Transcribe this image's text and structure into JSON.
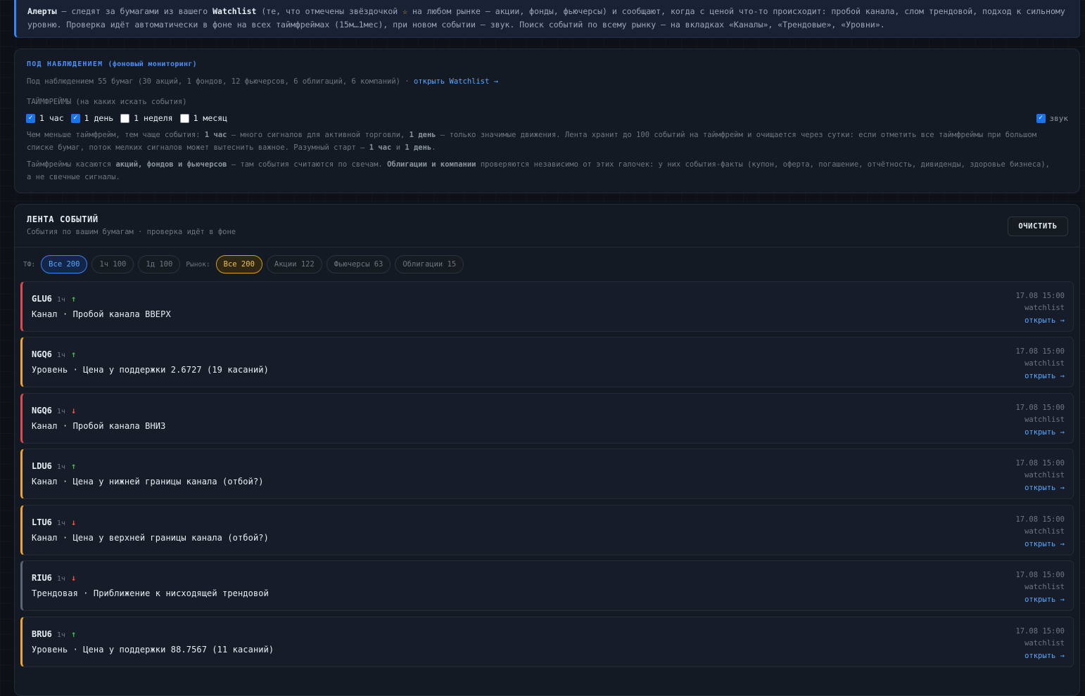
{
  "info_banner": {
    "b1": "Алерты",
    "t1": " — следят за бумагами из вашего ",
    "b2": "Watchlist",
    "t2": " (те, что отмечены звёздочкой ",
    "star": "☆",
    "t3": " на любом рынке — акции, фонды, фьючерсы) и сообщают, когда с ценой что-то происходит: пробой канала, слом трендовой, подход к сильному уровню. Проверка идёт автоматически в фоне на всех таймфреймах (15м…1мес), при новом событии — звук. Поиск событий по всему рынку — на вкладках «Каналы», «Трендовые», «Уровни»."
  },
  "monitoring": {
    "title": "ПОД НАБЛЮДЕНИЕМ",
    "title_sub": "(фоновый мониторинг)",
    "count_text": "Под наблюдением 55 бумаг (30 акций, 1 фондов, 12 фьючерсов, 6 облигаций, 6 компаний) · ",
    "watchlist_link": "открыть Watchlist →",
    "timeframes_title": "ТАЙМФРЕЙМЫ (на каких искать события)",
    "timeframes": [
      {
        "label": "1 час",
        "checked": true
      },
      {
        "label": "1 день",
        "checked": true
      },
      {
        "label": "1 неделя",
        "checked": false
      },
      {
        "label": "1 месяц",
        "checked": false
      }
    ],
    "sound": {
      "label": "звук",
      "checked": true
    },
    "note1": {
      "a": "Чем меньше таймфрейм, тем чаще события: ",
      "b": "1 час",
      "c": " — много сигналов для активной торговли, ",
      "d": "1 день",
      "e": " — только значимые движения. Лента хранит до 100 событий на таймфрейм и очищается через сутки: если отметить все таймфреймы при большом списке бумаг, поток мелких сигналов может вытеснить важное. Разумный старт — ",
      "f": "1 час",
      "g": " и ",
      "h": "1 день",
      "i": "."
    },
    "note2": {
      "a": "Таймфреймы касаются ",
      "b": "акций, фондов и фьючерсов",
      "c": " — там события считаются по свечам. ",
      "d": "Облигации и компании",
      "e": " проверяются независимо от этих галочек: у них события-факты (купон, оферта, погашение, отчётность, дивиденды, здоровье бизнеса), а не свечные сигналы."
    }
  },
  "feed": {
    "title": "ЛЕНТА СОБЫТИЙ",
    "subtitle": "События по вашим бумагам · проверка идёт в фоне",
    "clear_label": "ОЧИСТИТЬ",
    "tf_label": "ТФ:",
    "tf_filters": [
      "Все 200",
      "1ч 100",
      "1д 100"
    ],
    "market_label": "Рынок:",
    "market_filters": [
      "Все 200",
      "Акции 122",
      "Фьючерсы 63",
      "Облигации 15"
    ],
    "events": [
      {
        "ticker": "GLU6",
        "tf": "1ч",
        "dir": "↑",
        "text": "Канал · Пробой канала ВВЕРХ",
        "time": "17.08 15:00",
        "source": "watchlist",
        "open": "открыть →",
        "color": "#e5484d"
      },
      {
        "ticker": "NGQ6",
        "tf": "1ч",
        "dir": "↑",
        "text": "Уровень · Цена у поддержки 2.6727 (19 касаний)",
        "time": "17.08 15:00",
        "source": "watchlist",
        "open": "открыть →",
        "color": "#f5a524"
      },
      {
        "ticker": "NGQ6",
        "tf": "1ч",
        "dir": "↓",
        "text": "Канал · Пробой канала ВНИЗ",
        "time": "17.08 15:00",
        "source": "watchlist",
        "open": "открыть →",
        "color": "#e5484d"
      },
      {
        "ticker": "LDU6",
        "tf": "1ч",
        "dir": "↑",
        "text": "Канал · Цена у нижней границы канала (отбой?)",
        "time": "17.08 15:00",
        "source": "watchlist",
        "open": "открыть →",
        "color": "#f5a524"
      },
      {
        "ticker": "LTU6",
        "tf": "1ч",
        "dir": "↓",
        "text": "Канал · Цена у верхней границы канала (отбой?)",
        "time": "17.08 15:00",
        "source": "watchlist",
        "open": "открыть →",
        "color": "#f5a524"
      },
      {
        "ticker": "RIU6",
        "tf": "1ч",
        "dir": "↓",
        "text": "Трендовая · Приближение к нисходящей трендовой",
        "time": "17.08 15:00",
        "source": "watchlist",
        "open": "открыть →",
        "color": "#5c6675"
      },
      {
        "ticker": "BRU6",
        "tf": "1ч",
        "dir": "↑",
        "text": "Уровень · Цена у поддержки 88.7567 (11 касаний)",
        "time": "17.08 15:00",
        "source": "watchlist",
        "open": "открыть →",
        "color": "#f5a524"
      }
    ]
  }
}
